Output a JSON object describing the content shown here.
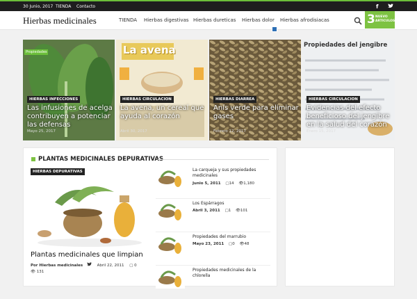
{
  "topbar": {
    "date": "30 Junio, 2017",
    "links": [
      "TIENDA",
      "Contacto"
    ],
    "social": [
      "f",
      "t"
    ]
  },
  "header": {
    "logo": "Hierbas medicinales",
    "nav": [
      "TIENDA",
      "Hierbas digestivas",
      "Hierbas dureticas",
      "Hierbas dolor",
      "Hierbas afrodisiacas"
    ],
    "badge": {
      "num": "3",
      "text": [
        "NUEVO",
        "ARTICULOS"
      ]
    }
  },
  "slides": [
    {
      "category": "HIERBAS INFECCIONES",
      "title": "Las infusiones de acelga contribuyen a potenciar las defensas",
      "date": "Mayo 25, 2017",
      "image_label": "Propiedades"
    },
    {
      "category": "HIERBAS CIRCULACION",
      "title": "La avena, un cereal que ayuda al corazón",
      "date": "Abril 30, 2017",
      "image_label": "La avena"
    },
    {
      "category": "HIERBAS DIARREA",
      "title": "Anís verde para eliminar gases",
      "date": "Febrero 12, 2017"
    },
    {
      "category": "HIERBAS CIRCULACION",
      "title": "Evidencias del efecto beneficioso del jengibre en la salud del corazón",
      "date": "Enero 15, 2017",
      "image_label": "Propiedades del jengibre"
    }
  ],
  "section": {
    "heading": "PLANTAS MEDICINALES DEPURATIVAS",
    "featured": {
      "category": "HIERBAS DEPURATIVAS",
      "title": "Plantas medicinales que limpian",
      "author": "Por Hierbas medicinales",
      "date": "Abril 22, 2011",
      "comments": "0",
      "views": "131"
    },
    "list": [
      {
        "title": "La carqueja y sus propiedades medicinales",
        "date": "Junio 5, 2011",
        "comments": "14",
        "views": "1,180"
      },
      {
        "title": "Los Espárragos",
        "date": "Abril 3, 2011",
        "comments": "1",
        "views": "101"
      },
      {
        "title": "Propiedades del marrubio",
        "date": "Mayo 23, 2011",
        "comments": "0",
        "views": "48"
      },
      {
        "title": "Propiedades medicinales de la chlorella",
        "date": "",
        "comments": "",
        "views": ""
      }
    ]
  },
  "colors": {
    "accent": "#7dc242",
    "dark": "#1e1e1e"
  }
}
